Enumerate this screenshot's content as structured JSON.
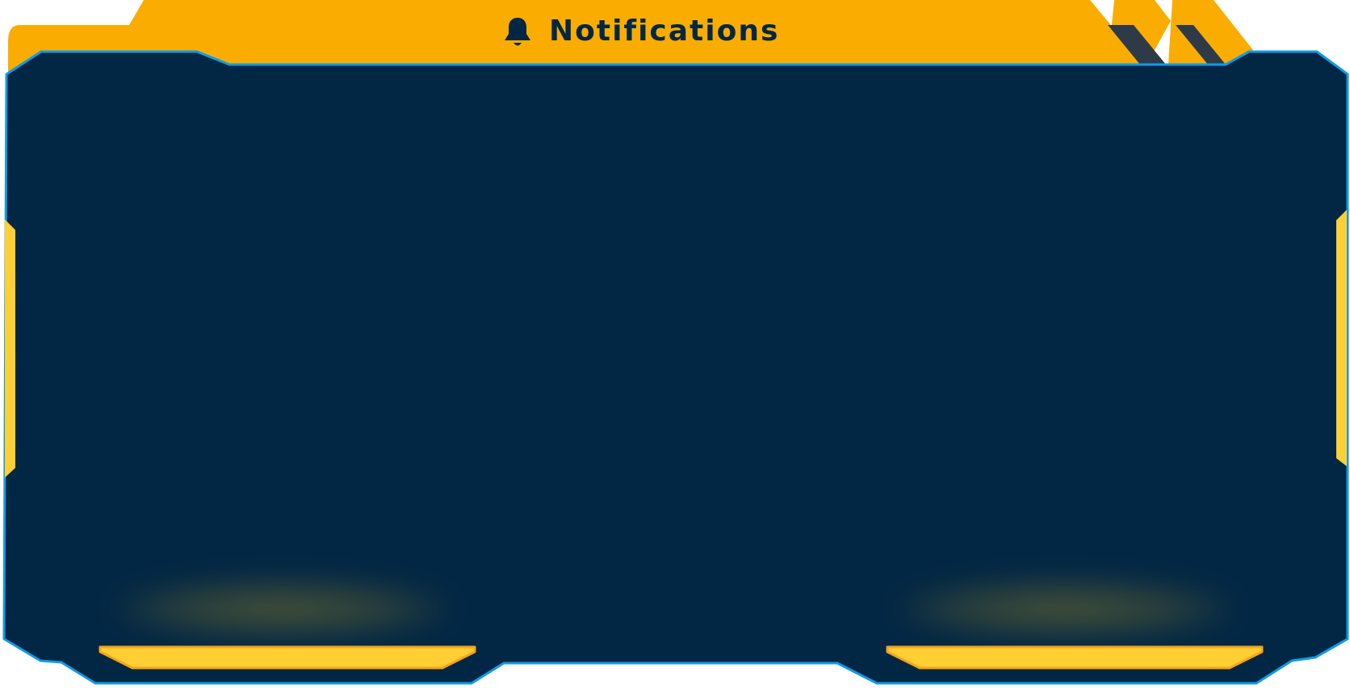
{
  "header": {
    "title": "Notifications",
    "icon": "bell-icon"
  },
  "notifications": [],
  "colors": {
    "accent": "#FAAD00",
    "panel": "#022744",
    "border": "#0E9BE8",
    "button_yellow": "#FFCF33",
    "stripe_dark": "#2E3A48"
  }
}
